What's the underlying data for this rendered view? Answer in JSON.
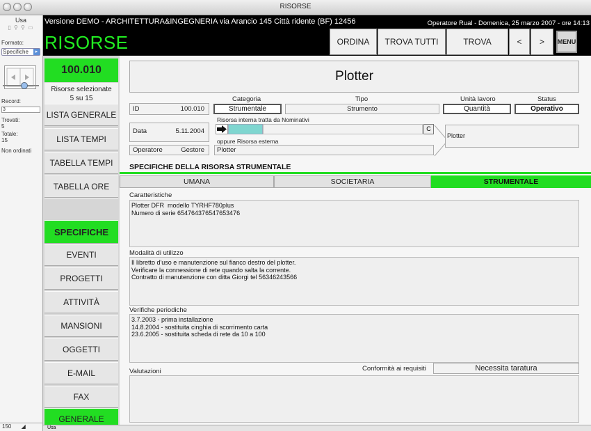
{
  "window": {
    "title": "RISORSE"
  },
  "palette": {
    "mode": "Usa",
    "format_label": "Formato:",
    "format_value": "Specifiche",
    "record_label": "Record:",
    "record_value": "3",
    "found_label": "Trovati:",
    "found_value": "5",
    "total_label": "Totale:",
    "total_value": "15",
    "sort_status": "Non ordinati",
    "zoom": "150",
    "status_mode": "Usa"
  },
  "topbar": {
    "demo_text": "Versione DEMO - ARCHITETTURA&INGEGNERIA via Arancio 145 Città ridente (BF) 12456",
    "operator_text": "Operatore Rual - Domenica, 25 marzo 2007 - ore 14:13",
    "brand": "RISORSE",
    "buttons": {
      "ordina": "ORDINA",
      "trova_tutti": "TROVA TUTTI",
      "trova": "TROVA",
      "prev": "<",
      "next": ">",
      "menu_line1": "ME",
      "menu_line2": "NU"
    }
  },
  "nav": {
    "id": "100.010",
    "selected_label": "Risorse selezionate",
    "selected_count": "5 su 15",
    "items": {
      "lista_generale": "LISTA GENERALE",
      "lista_tempi": "LISTA TEMPI",
      "tabella_tempi": "TABELLA TEMPI",
      "tabella_ore": "TABELLA ORE",
      "specifiche": "SPECIFICHE",
      "eventi": "EVENTI",
      "progetti": "PROGETTI",
      "attivita": "ATTIVITÀ",
      "mansioni": "MANSIONI",
      "oggetti": "OGGETTI",
      "email": "E-MAIL",
      "fax": "FAX",
      "generale": "GENERALE"
    }
  },
  "record": {
    "name": "Plotter",
    "headers": {
      "categoria": "Categoria",
      "tipo": "Tipo",
      "unita_lavoro": "Unità lavoro",
      "status": "Status"
    },
    "id_label": "ID",
    "id_value": "100.010",
    "categoria": "Strumentale",
    "tipo": "Strumento",
    "unita_lavoro": "Quantità",
    "status": "Operativo",
    "data_label": "Data",
    "data_value": "5.11.2004",
    "internal_label": "Risorsa interna tratta da Nominativi",
    "clear_button": "C",
    "external_label": "oppure Risorsa esterna",
    "external_value": "Plotter",
    "resolved_name": "Plotter",
    "operatore_label": "Operatore",
    "operatore_value": "Gestore"
  },
  "section": {
    "title": "SPECIFICHE DELLA RISORSA STRUMENTALE",
    "tabs": {
      "umana": "UMANA",
      "societaria": "SOCIETARIA",
      "strumentale": "STRUMENTALE"
    },
    "caratteristiche_label": "Caratteristiche",
    "caratteristiche": "Plotter DFR  modello TYRHF780plus\nNumero di serie 654764376547653476",
    "modalita_label": "Modalità di utilizzo",
    "modalita": "Il libretto d'uso e manutenzione sul fianco destro del plotter.\nVerificare la connessione di rete quando salta la corrente.\nContratto di manutenzione con ditta Giorgi tel 56346243566",
    "verifiche_label": "Verifiche periodiche",
    "verifiche": "3.7.2003 - prima installazione\n14.8.2004 - sostituita cinghia di scorrimento carta\n23.6.2005 - sostituita scheda di rete da 10 a 100",
    "valutazioni_label": "Valutazioni",
    "conformita_label": "Conformità ai requisiti",
    "conformita_value": "Necessita taratura"
  }
}
